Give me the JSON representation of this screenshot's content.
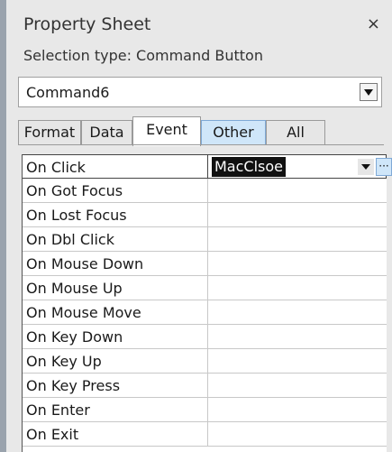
{
  "window": {
    "title": "Property Sheet",
    "close_glyph": "×",
    "selection_type_label": "Selection type:  Command Button"
  },
  "object_selector": {
    "value": "Command6"
  },
  "tabs": [
    {
      "label": "Format",
      "active": false
    },
    {
      "label": "Data",
      "active": false
    },
    {
      "label": "Event",
      "active": true
    },
    {
      "label": "Other",
      "active": false,
      "highlighted": true
    },
    {
      "label": "All",
      "active": false
    }
  ],
  "events": [
    {
      "name": "On Click",
      "value": "MacClsoe"
    },
    {
      "name": "On Got Focus",
      "value": ""
    },
    {
      "name": "On Lost Focus",
      "value": ""
    },
    {
      "name": "On Dbl Click",
      "value": ""
    },
    {
      "name": "On Mouse Down",
      "value": ""
    },
    {
      "name": "On Mouse Up",
      "value": ""
    },
    {
      "name": "On Mouse Move",
      "value": ""
    },
    {
      "name": "On Key Down",
      "value": ""
    },
    {
      "name": "On Key Up",
      "value": ""
    },
    {
      "name": "On Key Press",
      "value": ""
    },
    {
      "name": "On Enter",
      "value": ""
    },
    {
      "name": "On Exit",
      "value": ""
    }
  ],
  "builder_glyph": "···",
  "colors": {
    "selected_value_bg": "#111111",
    "tab_highlight": "#cfe6f9"
  }
}
